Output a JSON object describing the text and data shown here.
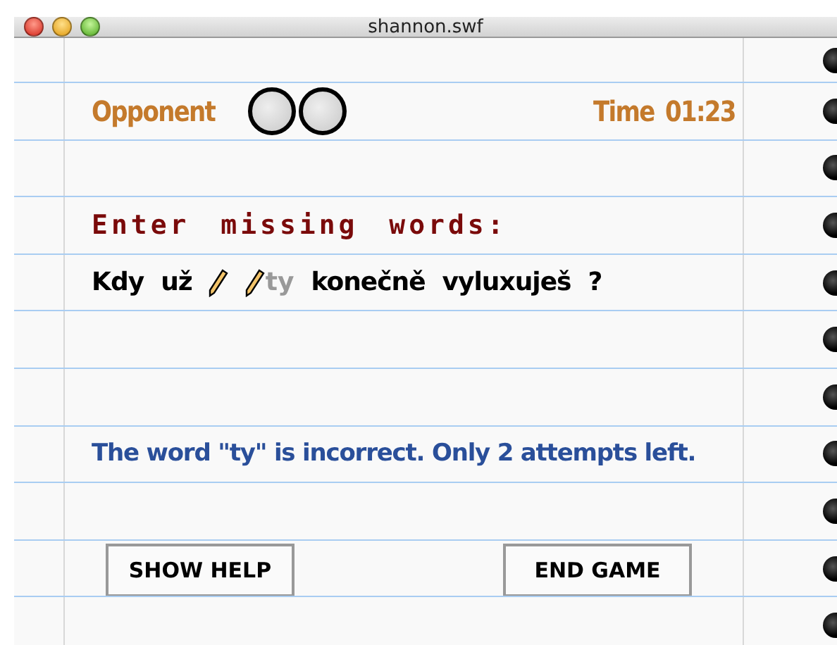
{
  "window": {
    "title": "shannon.swf"
  },
  "opponent": {
    "label": "Opponent",
    "markers": [
      {
        "filled": false
      },
      {
        "filled": false
      }
    ]
  },
  "timer": {
    "label": "Time",
    "value": "01:23"
  },
  "instruction": "Enter missing words:",
  "sentence": [
    {
      "kind": "word",
      "text": "Kdy"
    },
    {
      "kind": "word",
      "text": "už"
    },
    {
      "kind": "blank"
    },
    {
      "kind": "blank",
      "value": "ty"
    },
    {
      "kind": "word",
      "text": "konečně"
    },
    {
      "kind": "word",
      "text": "vyluxuješ"
    },
    {
      "kind": "word",
      "text": "?"
    }
  ],
  "message": "The word \"ty\" is incorrect. Only 2 attempts left.",
  "buttons": [
    "SHOW HELP",
    "END GAME"
  ]
}
